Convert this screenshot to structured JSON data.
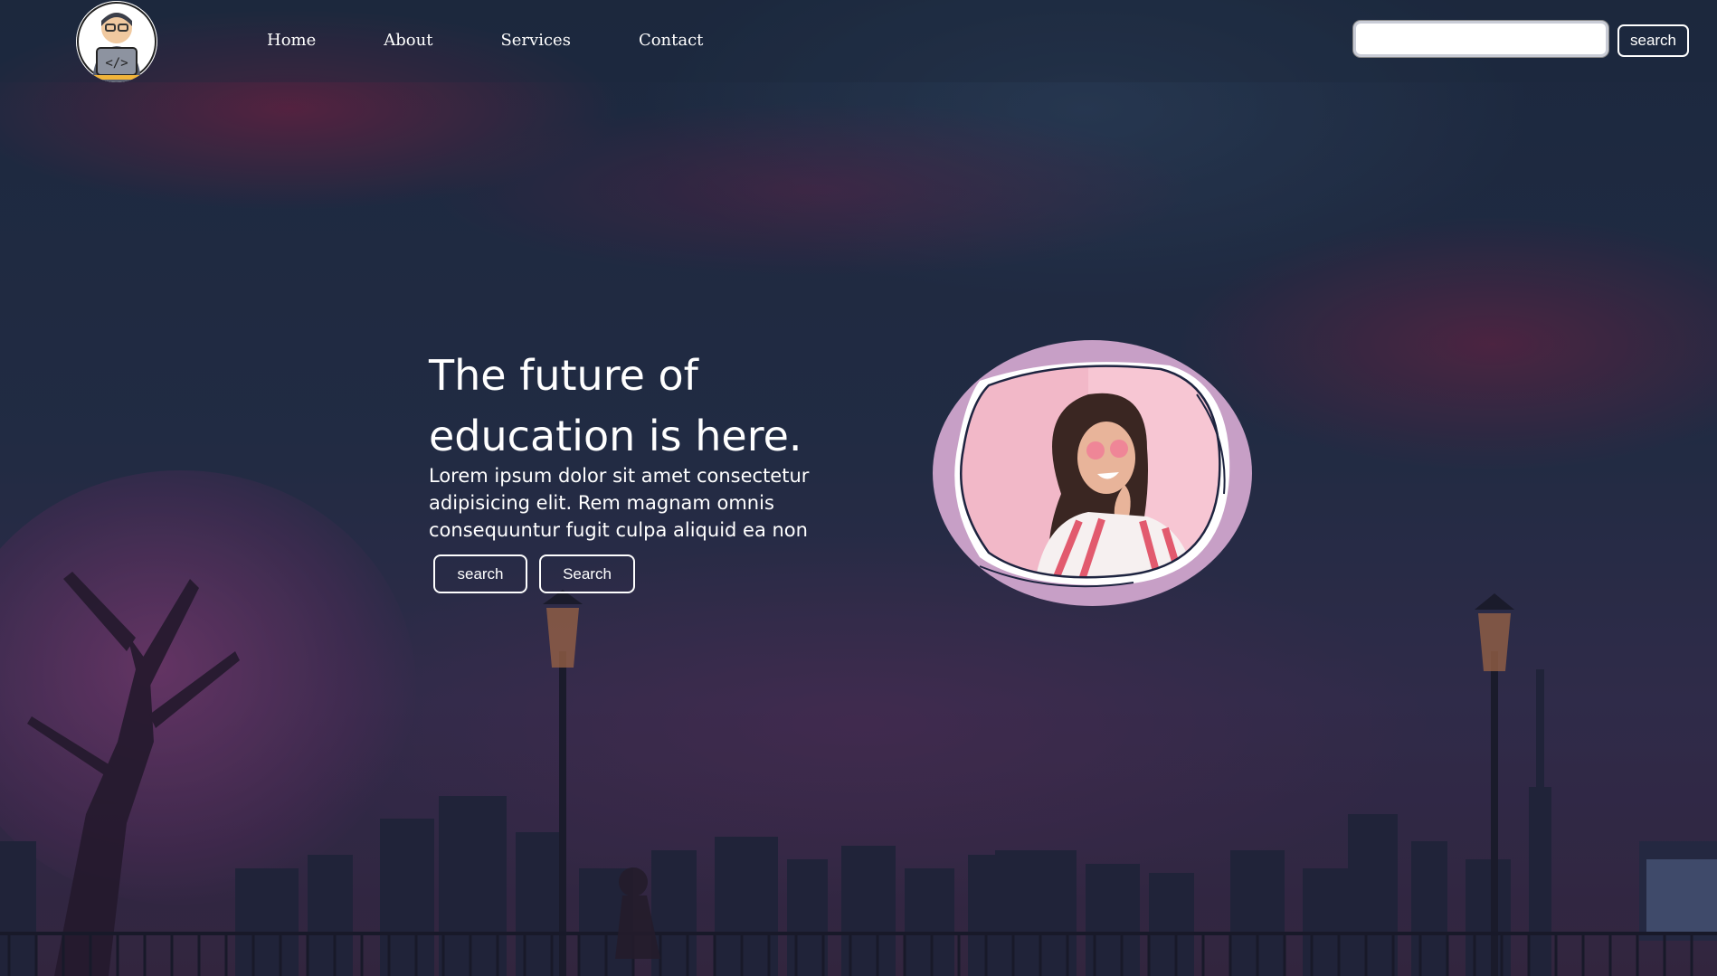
{
  "nav": {
    "logo_icon": "coder-avatar-icon",
    "links": [
      "Home",
      "About",
      "Services",
      "Contact"
    ],
    "search_placeholder": "",
    "search_button": "search"
  },
  "hero": {
    "title_line1": "The future of",
    "title_line2": "education is here.",
    "text": "Lorem ipsum dolor sit amet consectetur adipisicing elit. Rem magnam omnis consequuntur fugit culpa aliquid ea non",
    "button1": "search",
    "button2": "Search",
    "image_icon": "woman-portrait-icon"
  },
  "colors": {
    "ring": "#c79fc6",
    "photo_bg": "#f2b8c8",
    "sky": "#1f2f45"
  }
}
